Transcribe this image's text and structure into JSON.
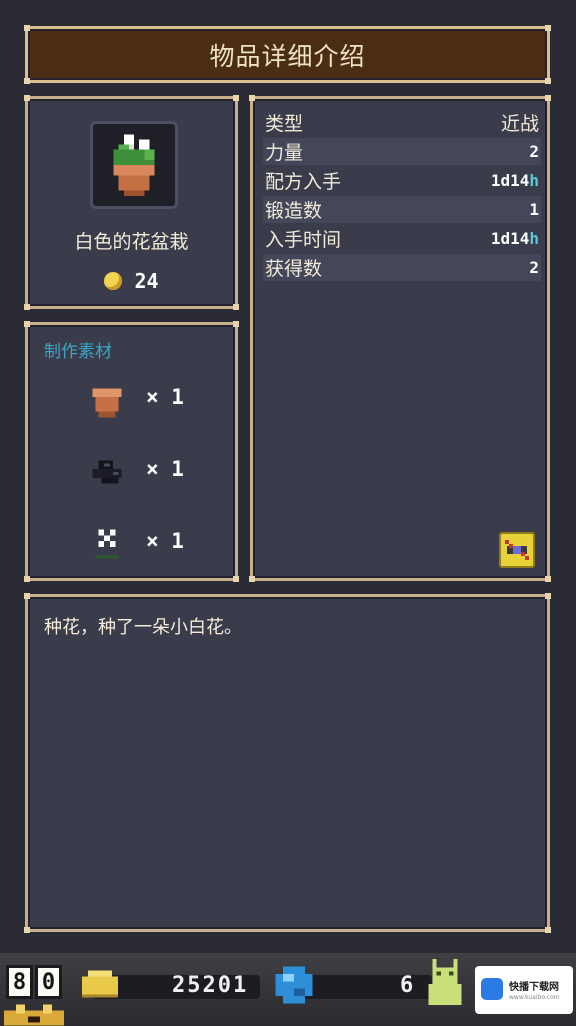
{
  "header": {
    "title": "物品详细介绍"
  },
  "item": {
    "name": "白色的花盆栽",
    "price": "24",
    "icon": "potted-white-flower-icon"
  },
  "stats": [
    {
      "label": "类型",
      "value": "近战"
    },
    {
      "label": "力量",
      "value": "2"
    },
    {
      "label": "配方入手",
      "value_num": "1d14",
      "value_unit": "h"
    },
    {
      "label": "锻造数",
      "value": "1"
    },
    {
      "label": "入手时间",
      "value_num": "1d14",
      "value_unit": "h"
    },
    {
      "label": "获得数",
      "value": "2"
    }
  ],
  "materials": {
    "title": "制作素材",
    "items": [
      {
        "icon": "clay-pot-icon",
        "qty": "× 1"
      },
      {
        "icon": "dark-soil-icon",
        "qty": "× 1"
      },
      {
        "icon": "white-flower-seed-icon",
        "qty": "× 1"
      }
    ]
  },
  "description": "种花，种了一朵小白花。",
  "hud": {
    "digits": [
      "8",
      "0"
    ],
    "gold": "25201",
    "gems": "6"
  },
  "watermark": {
    "title": "快播下载网",
    "sub": "www.kuaibo.com"
  },
  "colors": {
    "panel_bg": "#3a3c4b",
    "panel_border": "#c9b08a",
    "title_bg": "#4a2d14",
    "accent_cyan": "#3aa5c4",
    "coin": "#f3d44f"
  }
}
